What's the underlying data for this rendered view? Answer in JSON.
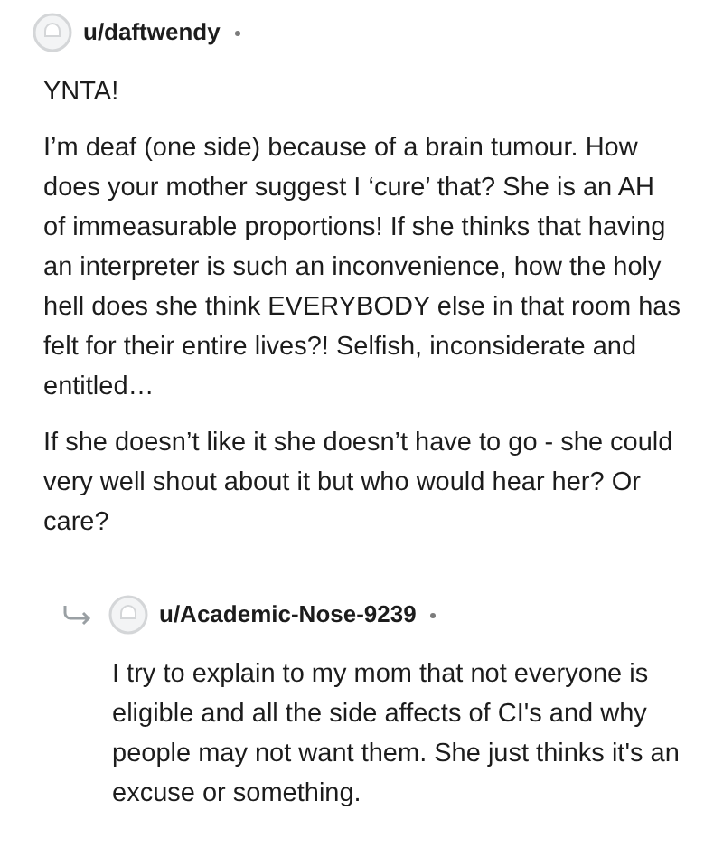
{
  "comments": [
    {
      "username": "u/daftwendy",
      "is_reply": false,
      "paragraphs": [
        "YNTA!",
        "I’m deaf (one side) because of a brain tumour. How does your mother suggest I ‘cure’ that? She is an AH of immeasurable proportions! If she thinks that having an interpreter is such an inconvenience, how the holy hell does she think EVERYBODY else in that room has felt for their entire lives?! Selfish, inconsiderate and entitled…",
        "If she doesn’t like it she doesn’t have to go - she could very well shout about it but who would hear her? Or care?"
      ]
    },
    {
      "username": "u/Academic-Nose-9239",
      "is_reply": true,
      "paragraphs": [
        "I try to explain to my mom that not everyone is eligible and all the side affects of CI's and why people may not want them. She just thinks it's an excuse or something."
      ]
    }
  ]
}
